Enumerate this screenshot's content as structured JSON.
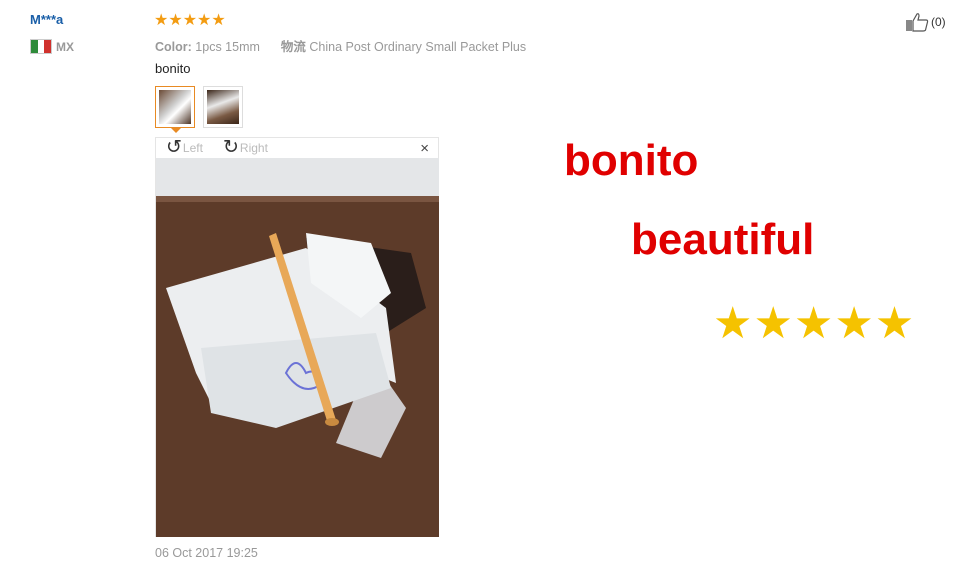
{
  "reviewer": {
    "name": "M***a",
    "country_code": "MX"
  },
  "review": {
    "rating_stars": "★★★★★",
    "rating": 5,
    "color_label": "Color:",
    "color_value": "1pcs 15mm",
    "shipping_label": "物流",
    "shipping_value": "China Post Ordinary Small Packet Plus",
    "text": "bonito",
    "date": "06 Oct 2017 19:25"
  },
  "viewer": {
    "rotate_left_label": "Left",
    "rotate_right_label": "Right",
    "close_symbol": "×"
  },
  "helpful": {
    "count": "(0)"
  },
  "overlay": {
    "line1": "bonito",
    "line2": "beautiful",
    "stars": "★★★★★"
  },
  "colors": {
    "star_orange": "#f39c12",
    "overlay_red": "#e00000",
    "overlay_gold": "#f5c200",
    "name_blue": "#1a5fa8"
  }
}
